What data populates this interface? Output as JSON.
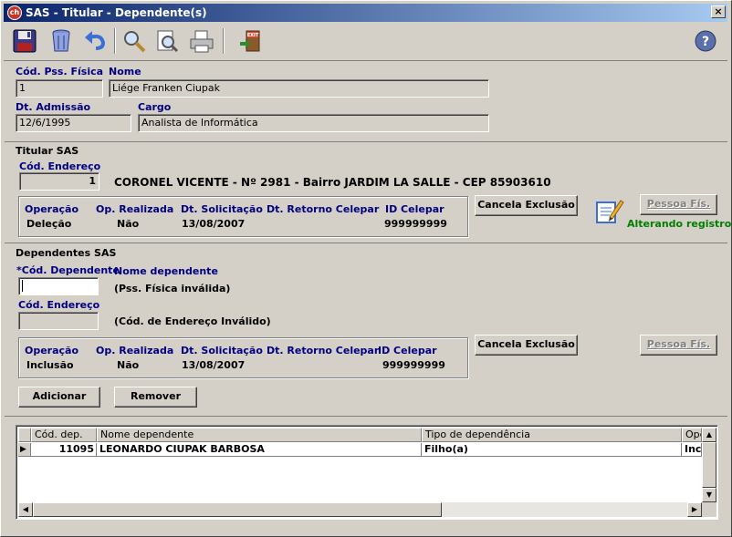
{
  "window": {
    "title": "SAS - Titular - Dependente(s)",
    "app_icon_text": "ch",
    "close_label": "×"
  },
  "toolbar": {
    "buttons": [
      {
        "name": "save",
        "icon": "floppy-disk-icon"
      },
      {
        "name": "delete",
        "icon": "trash-can-icon"
      },
      {
        "name": "undo",
        "icon": "undo-arrow-icon"
      },
      {
        "name": "search",
        "icon": "magnifier-icon"
      },
      {
        "name": "preview",
        "icon": "print-preview-icon"
      },
      {
        "name": "print",
        "icon": "printer-icon"
      },
      {
        "name": "exit",
        "icon": "exit-door-icon",
        "text": "EXIT"
      },
      {
        "name": "help",
        "icon": "help-icon",
        "text": "?"
      }
    ]
  },
  "person": {
    "cod_pss_label": "Cód. Pss. Física",
    "cod_pss_value": "1",
    "nome_label": "Nome",
    "nome_value": "Liége Franken Ciupak",
    "dt_admissao_label": "Dt. Admissão",
    "dt_admissao_value": "12/6/1995",
    "cargo_label": "Cargo",
    "cargo_value": "Analista de Informática"
  },
  "titular": {
    "section_title": "Titular SAS",
    "cod_endereco_label": "Cód. Endereço",
    "cod_endereco_value": "1",
    "endereco_text": "CORONEL VICENTE - Nº 2981 - Bairro JARDIM LA SALLE - CEP 85903610",
    "headers": {
      "operacao": "Operação",
      "op_realizada": "Op. Realizada",
      "dt_solicitacao": "Dt. Solicitação",
      "dt_retorno": "Dt. Retorno Celepar",
      "id_celepar": "ID Celepar"
    },
    "values": {
      "operacao": "Deleção",
      "op_realizada": "Não",
      "dt_solicitacao": "13/08/2007",
      "dt_retorno": "",
      "id_celepar": "999999999"
    },
    "cancela_label": "Cancela Exclusão",
    "pessoa_label": "Pessoa Fís.",
    "status_text": "Alterando registro."
  },
  "dependentes": {
    "section_title": "Dependentes SAS",
    "cod_dep_label": "*Cód. Dependente",
    "nome_dep_label": "Nome dependente",
    "cod_dep_value": "",
    "pss_invalid_text": "(Pss. Física inválida)",
    "cod_endereco_label": "Cód. Endereço",
    "cod_endereco_value": "",
    "endereco_invalid_text": "(Cód. de Endereço Inválido)",
    "headers": {
      "operacao": "Operação",
      "op_realizada": "Op. Realizada",
      "dt_solicitacao": "Dt. Solicitação",
      "dt_retorno": "Dt. Retorno Celepar",
      "id_celepar": "ID Celepar"
    },
    "values": {
      "operacao": "Inclusão",
      "op_realizada": "Não",
      "dt_solicitacao": "13/08/2007",
      "dt_retorno": "",
      "id_celepar": "999999999"
    },
    "cancela_label": "Cancela Exclusão",
    "pessoa_label": "Pessoa Fís.",
    "adicionar_label": "Adicionar",
    "remover_label": "Remover"
  },
  "grid": {
    "columns": [
      "Cód. dep.",
      "Nome dependente",
      "Tipo de dependência",
      "Ope"
    ],
    "rows": [
      {
        "cod": "11095",
        "nome": "LEONARDO CIUPAK BARBOSA",
        "tipo": "Filho(a)",
        "ope": "Incl"
      }
    ],
    "row_marker": "▶"
  },
  "colors": {
    "title_start": "#0a246a",
    "title_end": "#a6caf0",
    "label_blue": "#000080",
    "status_green": "#008000"
  }
}
